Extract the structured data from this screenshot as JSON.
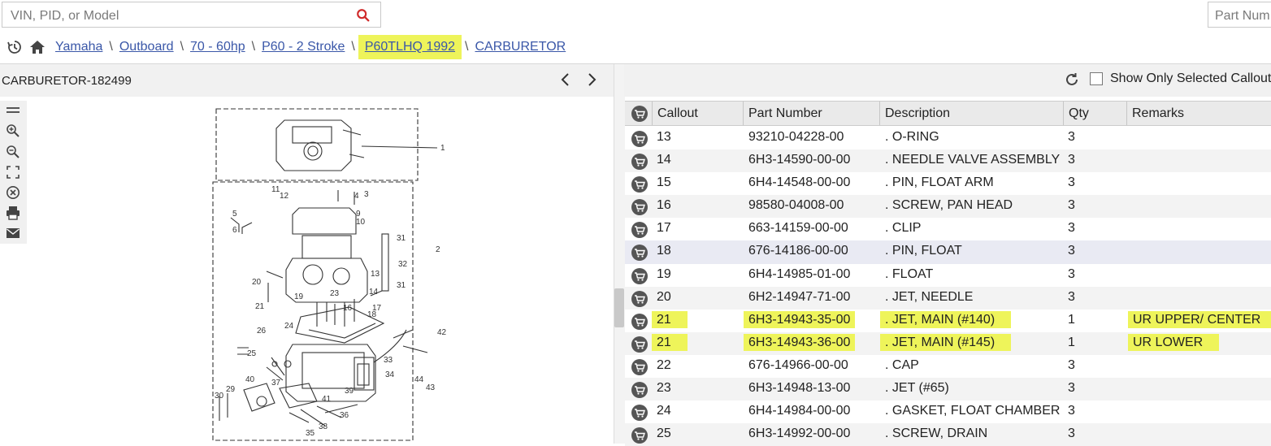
{
  "search": {
    "placeholder": "VIN, PID, or Model"
  },
  "part_search": {
    "placeholder": "Part Num"
  },
  "breadcrumb": [
    {
      "label": "Yamaha"
    },
    {
      "label": "Outboard"
    },
    {
      "label": "70 - 60hp"
    },
    {
      "label": "P60 - 2 Stroke"
    },
    {
      "label": "P60TLHQ 1992"
    },
    {
      "label": "CARBURETOR"
    }
  ],
  "breadcrumb_sep": "\\",
  "diagram": {
    "title": "CARBURETOR-182499"
  },
  "toolbar_icons": [
    "menu-icon",
    "zoom-in-icon",
    "zoom-out-icon",
    "fit-screen-icon",
    "close-circle-icon",
    "print-icon",
    "email-icon"
  ],
  "filter": {
    "checkbox_label": "Show Only Selected Callouts",
    "checked": false
  },
  "table": {
    "headers": {
      "callout": "Callout",
      "part_number": "Part Number",
      "description": "Description",
      "qty": "Qty",
      "remarks": "Remarks"
    },
    "rows": [
      {
        "callout": "13",
        "part_number": "93210-04228-00",
        "description": ". O-RING",
        "qty": "3",
        "remarks": ""
      },
      {
        "callout": "14",
        "part_number": "6H3-14590-00-00",
        "description": ". NEEDLE VALVE ASSEMBLY",
        "qty": "3",
        "remarks": ""
      },
      {
        "callout": "15",
        "part_number": "6H4-14548-00-00",
        "description": ". PIN, FLOAT ARM",
        "qty": "3",
        "remarks": ""
      },
      {
        "callout": "16",
        "part_number": "98580-04008-00",
        "description": ". SCREW, PAN HEAD",
        "qty": "3",
        "remarks": ""
      },
      {
        "callout": "17",
        "part_number": "663-14159-00-00",
        "description": ". CLIP",
        "qty": "3",
        "remarks": ""
      },
      {
        "callout": "18",
        "part_number": "676-14186-00-00",
        "description": ". PIN, FLOAT",
        "qty": "3",
        "remarks": ""
      },
      {
        "callout": "19",
        "part_number": "6H4-14985-01-00",
        "description": ". FLOAT",
        "qty": "3",
        "remarks": ""
      },
      {
        "callout": "20",
        "part_number": "6H2-14947-71-00",
        "description": ". JET, NEEDLE",
        "qty": "3",
        "remarks": ""
      },
      {
        "callout": "21",
        "part_number": "6H3-14943-35-00",
        "description": ". JET, MAIN (#140)",
        "qty": "1",
        "remarks": "UR UPPER/ CENTER"
      },
      {
        "callout": "21",
        "part_number": "6H3-14943-36-00",
        "description": ". JET, MAIN (#145)",
        "qty": "1",
        "remarks": "UR LOWER"
      },
      {
        "callout": "22",
        "part_number": "676-14966-00-00",
        "description": ". CAP",
        "qty": "3",
        "remarks": ""
      },
      {
        "callout": "23",
        "part_number": "6H3-14948-13-00",
        "description": ". JET (#65)",
        "qty": "3",
        "remarks": ""
      },
      {
        "callout": "24",
        "part_number": "6H4-14984-00-00",
        "description": ". GASKET, FLOAT CHAMBER",
        "qty": "3",
        "remarks": ""
      },
      {
        "callout": "25",
        "part_number": "6H3-14992-00-00",
        "description": ". SCREW, DRAIN",
        "qty": "3",
        "remarks": ""
      }
    ]
  },
  "diagram_labels": [
    "1",
    "2",
    "3",
    "4",
    "5",
    "6",
    "9",
    "10",
    "11",
    "12",
    "13",
    "14",
    "16",
    "17",
    "18",
    "19",
    "20",
    "21",
    "23",
    "24",
    "25",
    "26",
    "29",
    "30",
    "31",
    "32",
    "33",
    "34",
    "35",
    "36",
    "37",
    "38",
    "39",
    "40",
    "41",
    "42",
    "43",
    "44"
  ],
  "colors": {
    "highlight": "#eef45a",
    "link": "#3a57a8",
    "search_icon": "#d02b2b"
  }
}
